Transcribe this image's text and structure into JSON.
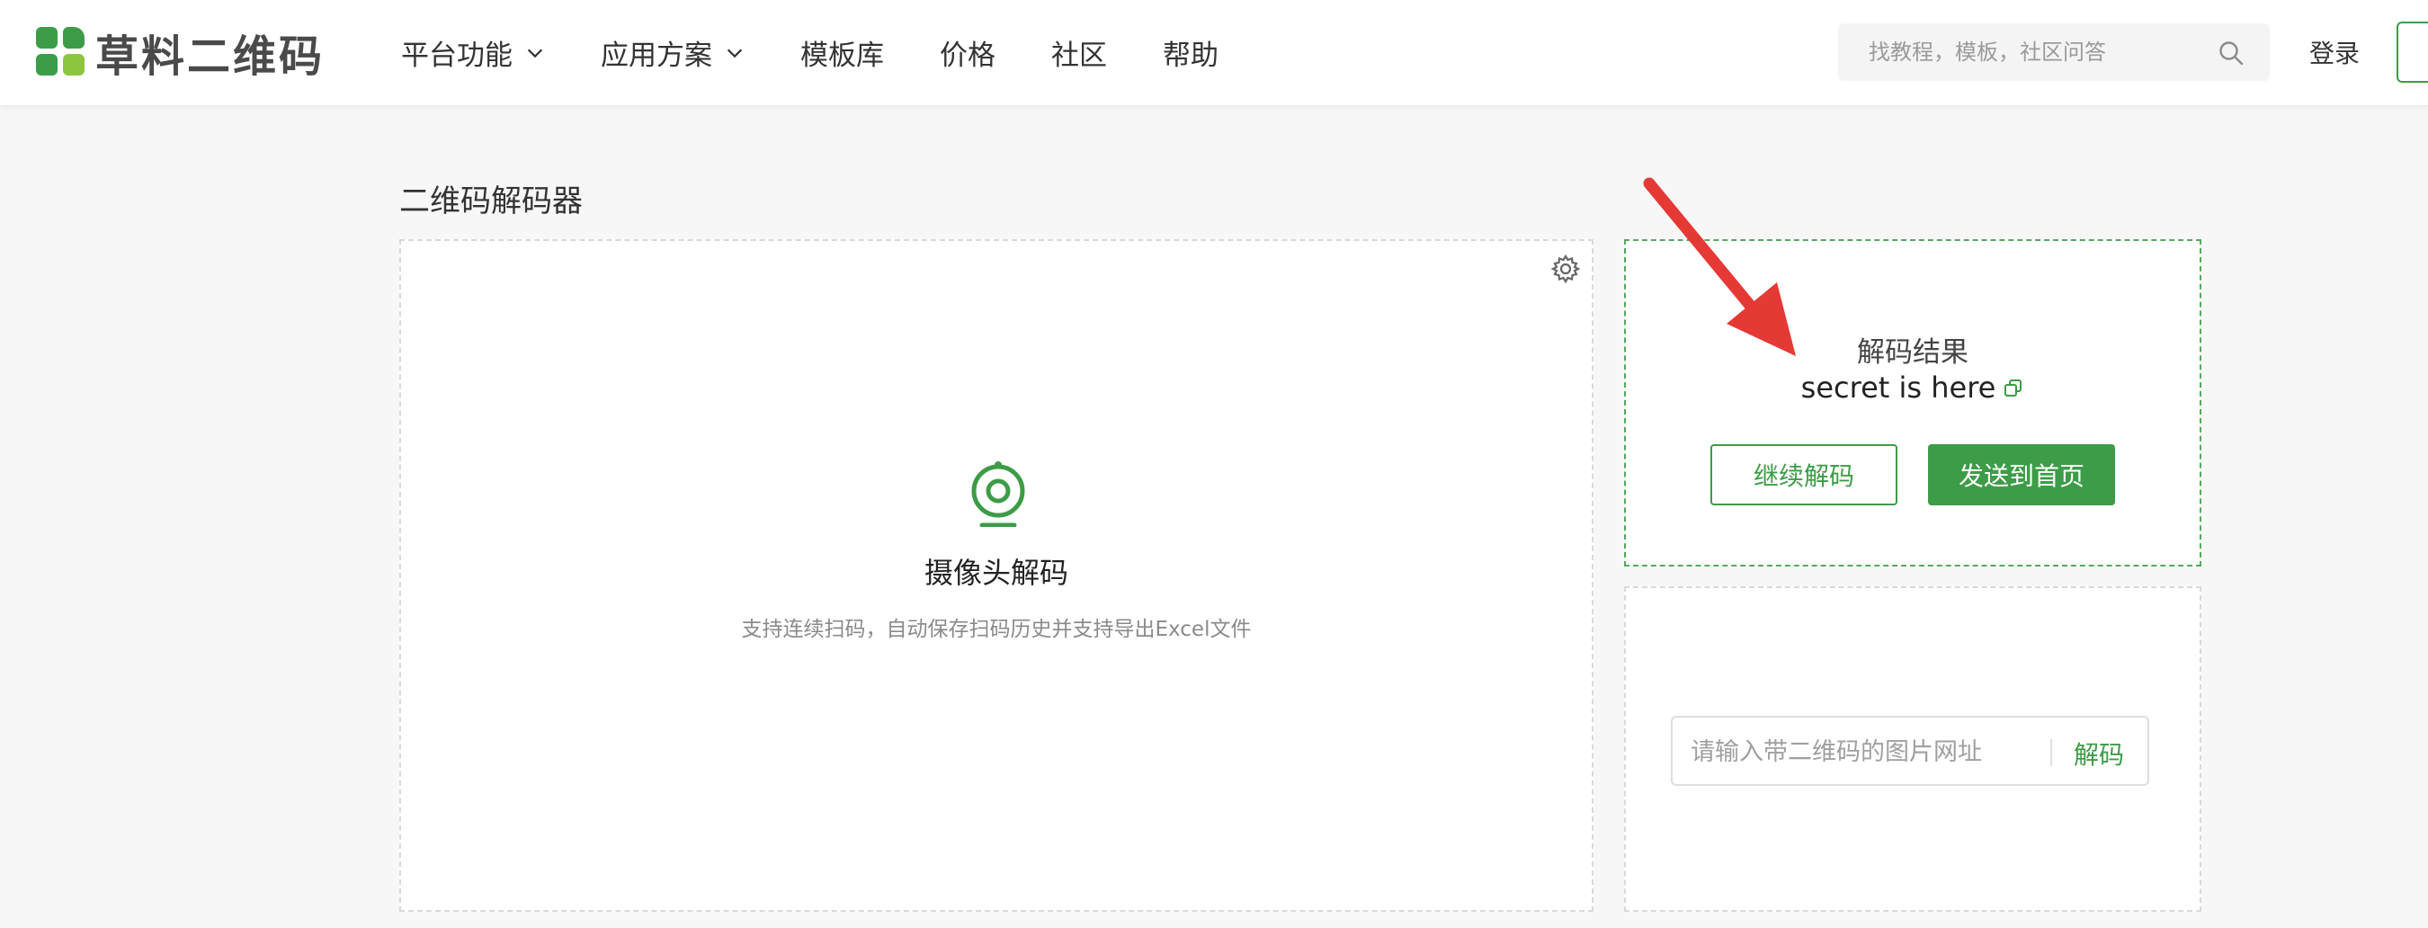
{
  "header": {
    "logo_text": "草料二维码",
    "nav": [
      {
        "label": "平台功能",
        "has_dropdown": true
      },
      {
        "label": "应用方案",
        "has_dropdown": true
      },
      {
        "label": "模板库",
        "has_dropdown": false
      },
      {
        "label": "价格",
        "has_dropdown": false
      },
      {
        "label": "社区",
        "has_dropdown": false
      },
      {
        "label": "帮助",
        "has_dropdown": false
      }
    ],
    "search_placeholder": "找教程，模板，社区问答",
    "login_label": "登录"
  },
  "page": {
    "title": "二维码解码器"
  },
  "camera_panel": {
    "title": "摄像头解码",
    "subtitle": "支持连续扫码，自动保存扫码历史并支持导出Excel文件"
  },
  "result_panel": {
    "label": "解码结果",
    "value": "secret is here",
    "continue_button": "继续解码",
    "send_button": "发送到首页"
  },
  "url_panel": {
    "placeholder": "请输入带二维码的图片网址",
    "decode_button": "解码"
  },
  "colors": {
    "brand_green": "#3d9c47",
    "logo_light_green": "#8cc63f",
    "annotation_arrow": "#e53935"
  }
}
